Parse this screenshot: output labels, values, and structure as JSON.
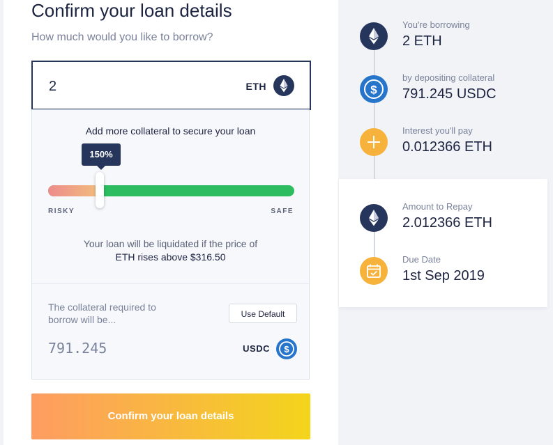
{
  "loan_form": {
    "title": "Confirm your loan details",
    "prompt": "How much would you like to borrow?",
    "amount_value": "2",
    "amount_currency": "ETH"
  },
  "collateral": {
    "heading": "Add more collateral to secure your loan",
    "ratio_label": "150%",
    "slider_fraction": 0.21,
    "risky_label": "RISKY",
    "safe_label": "SAFE",
    "liquidation_line1": "Your loan will be liquidated if the price of",
    "liquidation_line2": "ETH rises above $316.50",
    "required_text": "The collateral required to borrow will be...",
    "use_default_label": "Use Default",
    "required_value": "791.245",
    "required_currency": "USDC"
  },
  "confirm_button_label": "Confirm your loan details",
  "summary": {
    "borrowing_label": "You're borrowing",
    "borrowing_value": "2 ETH",
    "collateral_label": "by depositing collateral",
    "collateral_value": "791.245 USDC",
    "interest_label": "Interest you'll pay",
    "interest_value": "0.012366 ETH",
    "repay_label": "Amount to Repay",
    "repay_value": "2.012366 ETH",
    "due_label": "Due Date",
    "due_value": "1st Sep 2019"
  },
  "icons": {
    "eth": "ethereum-icon",
    "usdc": "usdc-icon",
    "plus": "plus-icon",
    "calendar": "calendar-icon"
  },
  "colors": {
    "navy": "#26355c",
    "usdc_blue": "#2775ca",
    "safe_green": "#2dbd60",
    "accent_orange": "#f7b23b",
    "button_gradient_start": "#fe9c62",
    "button_gradient_end": "#f3d51c"
  }
}
